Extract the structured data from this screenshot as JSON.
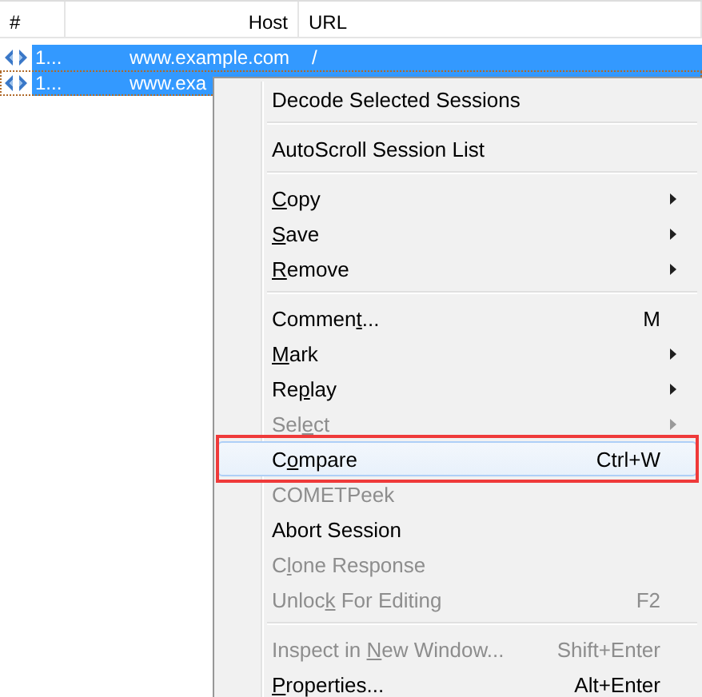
{
  "session_list": {
    "columns": [
      "#",
      "Host",
      "URL"
    ],
    "rows": [
      {
        "number": "1...",
        "host": "www.example.com",
        "url": "/",
        "selected": true,
        "focused": false
      },
      {
        "number": "1...",
        "host": "www.exa",
        "selected": true,
        "focused": true
      }
    ]
  },
  "context_menu": {
    "items": [
      {
        "kind": "item",
        "label": {
          "before": "Decode Selected Sessions"
        },
        "disabled": false,
        "submenu": false,
        "selected": false,
        "annotated": false
      },
      {
        "kind": "separator"
      },
      {
        "kind": "item",
        "label": {
          "before": "AutoScroll Session List"
        },
        "disabled": false,
        "submenu": false,
        "selected": false,
        "annotated": false
      },
      {
        "kind": "separator"
      },
      {
        "kind": "item",
        "label": {
          "key": "C",
          "after": "opy"
        },
        "disabled": false,
        "submenu": true,
        "selected": false,
        "annotated": false
      },
      {
        "kind": "item",
        "label": {
          "key": "S",
          "after": "ave"
        },
        "disabled": false,
        "submenu": true,
        "selected": false,
        "annotated": false
      },
      {
        "kind": "item",
        "label": {
          "key": "R",
          "after": "emove"
        },
        "disabled": false,
        "submenu": true,
        "selected": false,
        "annotated": false
      },
      {
        "kind": "separator"
      },
      {
        "kind": "item",
        "label": {
          "before": "Commen",
          "key": "t",
          "after": "..."
        },
        "shortcut": "M",
        "disabled": false,
        "submenu": false,
        "selected": false,
        "annotated": false
      },
      {
        "kind": "item",
        "label": {
          "key": "M",
          "after": "ark"
        },
        "disabled": false,
        "submenu": true,
        "selected": false,
        "annotated": false
      },
      {
        "kind": "item",
        "label": {
          "before": "Re",
          "key": "p",
          "after": "lay"
        },
        "disabled": false,
        "submenu": true,
        "selected": false,
        "annotated": false
      },
      {
        "kind": "item",
        "label": {
          "before": "Sel",
          "key": "e",
          "after": "ct"
        },
        "disabled": true,
        "submenu": true,
        "selected": false,
        "annotated": false
      },
      {
        "kind": "item",
        "label": {
          "before": "C",
          "key": "o",
          "after": "mpare"
        },
        "shortcut": "Ctrl+W",
        "disabled": false,
        "submenu": false,
        "selected": true,
        "annotated": true
      },
      {
        "kind": "item",
        "label": {
          "before": "COMETPeek"
        },
        "disabled": true,
        "submenu": false,
        "selected": false,
        "annotated": false
      },
      {
        "kind": "item",
        "label": {
          "before": "Abort Session"
        },
        "disabled": false,
        "submenu": false,
        "selected": false,
        "annotated": false
      },
      {
        "kind": "item",
        "label": {
          "before": "C",
          "key": "l",
          "after": "one Response"
        },
        "disabled": true,
        "submenu": false,
        "selected": false,
        "annotated": false
      },
      {
        "kind": "item",
        "label": {
          "before": "Unloc",
          "key": "k",
          "after": " For Editing"
        },
        "shortcut": "F2",
        "disabled": true,
        "submenu": false,
        "selected": false,
        "annotated": false
      },
      {
        "kind": "separator"
      },
      {
        "kind": "item",
        "label": {
          "before": "Inspect in ",
          "key": "N",
          "after": "ew Window..."
        },
        "shortcut": "Shift+Enter",
        "disabled": true,
        "submenu": false,
        "selected": false,
        "annotated": false
      },
      {
        "kind": "item",
        "label": {
          "key": "P",
          "after": "roperties..."
        },
        "shortcut": "Alt+Enter",
        "disabled": false,
        "submenu": false,
        "selected": false,
        "annotated": false
      }
    ]
  }
}
